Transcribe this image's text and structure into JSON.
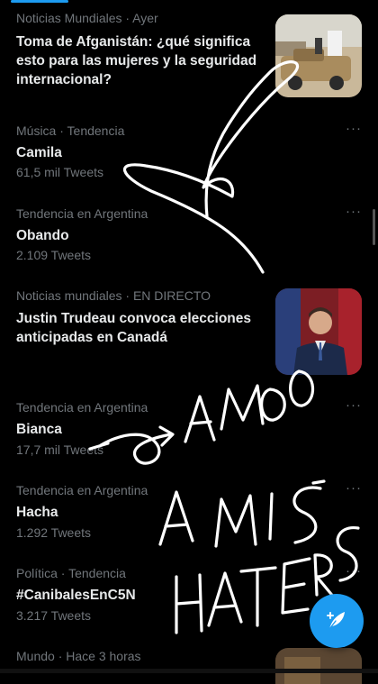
{
  "feed": {
    "items": [
      {
        "meta": "Noticias Mundiales · Ayer",
        "title": "Toma de Afganistán: ¿qué significa esto para las mujeres y la seguridad internacional?",
        "count": ""
      },
      {
        "meta": "Música · Tendencia",
        "title": "Camila",
        "count": "61,5 mil Tweets",
        "more": "···"
      },
      {
        "meta": "Tendencia en Argentina",
        "title": "Obando",
        "count": "2.109 Tweets",
        "more": "···"
      },
      {
        "meta": "Noticias mundiales · EN DIRECTO",
        "title": "Justin Trudeau convoca elecciones anticipadas en Canadá",
        "count": ""
      },
      {
        "meta": "Tendencia en Argentina",
        "title": "Bianca",
        "count": "17,7 mil Tweets",
        "more": "···"
      },
      {
        "meta": "Tendencia en Argentina",
        "title": "Hacha",
        "count": "1.292 Tweets",
        "more": "···"
      },
      {
        "meta": "Política · Tendencia",
        "title": "#CanibalesEnC5N",
        "count": "3.217 Tweets",
        "more": "···"
      },
      {
        "meta": "Mundo · Hace 3 horas",
        "title": "",
        "count": ""
      }
    ]
  },
  "overlay": {
    "handwriting": [
      "AMO",
      "A MIS",
      "HATERS"
    ]
  },
  "colors": {
    "accent": "#1d9bf0",
    "background": "#000000",
    "muted": "#71767b"
  },
  "fab": {
    "icon": "compose-feather-icon"
  }
}
